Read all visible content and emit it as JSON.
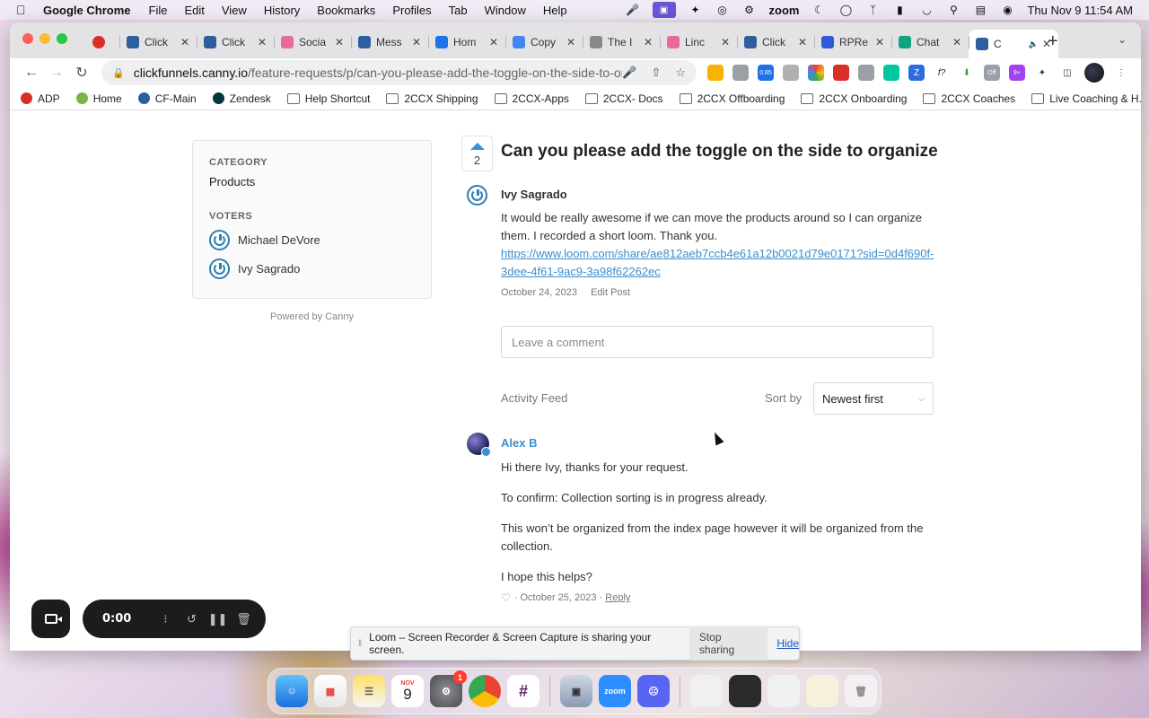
{
  "menubar": {
    "app_name": "Google Chrome",
    "items": [
      "File",
      "Edit",
      "View",
      "History",
      "Bookmarks",
      "Profiles",
      "Tab",
      "Window",
      "Help"
    ],
    "zoom_label": "zoom",
    "clock": "Thu Nov 9  11:54 AM"
  },
  "tabs": [
    {
      "label": "",
      "favicon_color": "#d93025",
      "icon": "record-icon"
    },
    {
      "label": "Click",
      "favicon_color": "#2d5f9e",
      "icon": "clickfunnels-icon"
    },
    {
      "label": "Click",
      "favicon_color": "#2d5f9e",
      "icon": "clickfunnels-icon"
    },
    {
      "label": "Socia",
      "favicon_color": "#e86a9b",
      "icon": "social-icon"
    },
    {
      "label": "Mess",
      "favicon_color": "#2d5f9e",
      "icon": "clickfunnels-icon"
    },
    {
      "label": "Hom",
      "favicon_color": "#1a73e8",
      "icon": "home-icon"
    },
    {
      "label": "Copy",
      "favicon_color": "#4285f4",
      "icon": "docs-icon"
    },
    {
      "label": "The I",
      "favicon_color": "#888888",
      "icon": "page-icon"
    },
    {
      "label": "Linc",
      "favicon_color": "#e86a9b",
      "icon": "social-icon"
    },
    {
      "label": "Click",
      "favicon_color": "#2d5f9e",
      "icon": "clickfunnels-icon"
    },
    {
      "label": "RPRe",
      "favicon_color": "#2e5bd6",
      "icon": "rp-icon"
    },
    {
      "label": "Chat",
      "favicon_color": "#10a37f",
      "icon": "chatgpt-icon"
    },
    {
      "label": "C",
      "favicon_color": "#2d5f9e",
      "icon": "clickfunnels-icon",
      "active": true
    }
  ],
  "omnibox": {
    "url_host": "clickfunnels.canny.io",
    "url_path": "/feature-requests/p/can-you-please-add-the-toggle-on-the-side-to-or..."
  },
  "extensions": {
    "badge_value": "0.85",
    "off_label": "Off",
    "nine_plus": "9+"
  },
  "bookmarks": [
    {
      "label": "ADP",
      "icon": "adp-icon"
    },
    {
      "label": "Home",
      "icon": "home-icon"
    },
    {
      "label": "CF-Main",
      "icon": "clickfunnels-icon"
    },
    {
      "label": "Zendesk",
      "icon": "zendesk-icon"
    },
    {
      "label": "Help Shortcut",
      "icon": "folder-icon"
    },
    {
      "label": "2CCX Shipping",
      "icon": "folder-icon"
    },
    {
      "label": "2CCX-Apps",
      "icon": "folder-icon"
    },
    {
      "label": "2CCX- Docs",
      "icon": "folder-icon"
    },
    {
      "label": "2CCX Offboarding",
      "icon": "folder-icon"
    },
    {
      "label": "2CCX Onboarding",
      "icon": "folder-icon"
    },
    {
      "label": "2CCX Coaches",
      "icon": "folder-icon"
    },
    {
      "label": "Live Coaching & H...",
      "icon": "folder-icon"
    }
  ],
  "sidebar": {
    "category_heading": "CATEGORY",
    "category_value": "Products",
    "voters_heading": "VOTERS",
    "voters": [
      "Michael DeVore",
      "Ivy Sagrado"
    ],
    "powered_by": "Powered by Canny"
  },
  "post": {
    "vote_count": "2",
    "title": "Can you please add the toggle on the side to organize",
    "author": "Ivy Sagrado",
    "body": "It would be really awesome if we can move the products around so I can organize them. I recorded a short loom. Thank you.",
    "link": "https://www.loom.com/share/ae812aeb7ccb4e61a12b0021d79e0171?sid=0d4f690f-3dee-4f61-9ac9-3a98f62262ec",
    "date": "October 24, 2023",
    "edit_label": "Edit Post"
  },
  "comment_input": {
    "placeholder": "Leave a comment"
  },
  "feed": {
    "label": "Activity Feed",
    "sort_label": "Sort by",
    "sort_value": "Newest first"
  },
  "comment": {
    "author": "Alex B",
    "paragraphs": [
      "Hi there Ivy, thanks for your request.",
      "To confirm: Collection sorting is in progress already.",
      "This won’t be organized from the index page however it will be organized from the collection.",
      "I hope this helps?"
    ],
    "date": "October 25, 2023",
    "reply_label": "Reply"
  },
  "loom": {
    "timer": "0:00",
    "share_message": "Loom – Screen Recorder & Screen Capture is sharing your screen.",
    "stop_label": "Stop sharing",
    "hide_label": "Hide"
  },
  "dock": {
    "calendar_month": "NOV",
    "calendar_day": "9",
    "settings_badge": "1",
    "zoom_label": "zoom"
  }
}
